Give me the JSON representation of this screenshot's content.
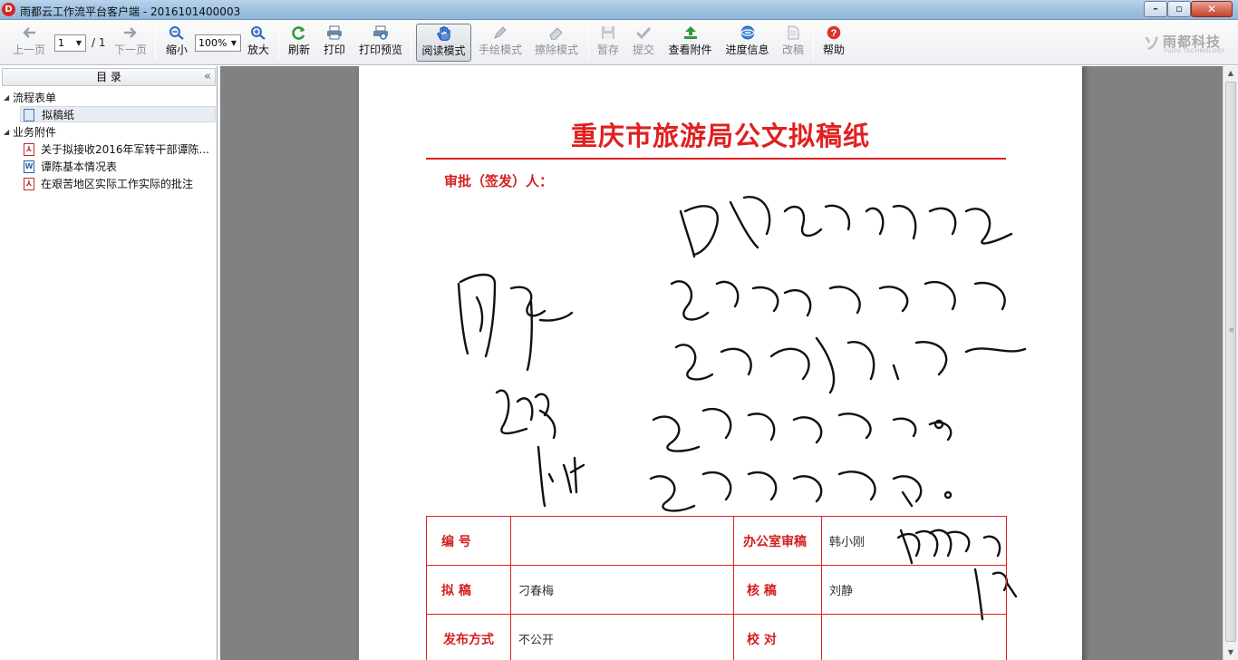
{
  "window": {
    "title": "雨都云工作流平台客户端 - 2016101400003",
    "app_icon": "D",
    "controls": {
      "minimize": "–",
      "maximize": "▫",
      "close": "✕"
    }
  },
  "toolbar": {
    "prev_page": "上一页",
    "page_current": "1",
    "page_total": "/ 1",
    "next_page": "下一页",
    "zoom_out": "缩小",
    "zoom_value": "100%",
    "zoom_in": "放大",
    "refresh": "刷新",
    "print": "打印",
    "print_preview": "打印预览",
    "read_mode": "阅读模式",
    "draw_mode": "手绘模式",
    "erase_mode": "擦除模式",
    "save_draft": "暂存",
    "submit": "提交",
    "view_attachments": "查看附件",
    "progress_info": "进度信息",
    "revise": "改稿",
    "help": "帮助"
  },
  "brand": {
    "mark": "ソ",
    "name_cn": "雨都科技",
    "name_en": "YUDU TECHNOLOGY"
  },
  "sidebar": {
    "title": "目 录",
    "collapse_glyph": "«",
    "groups": [
      {
        "label": "流程表单",
        "items": [
          {
            "label": "拟稿纸",
            "type": "form"
          }
        ]
      },
      {
        "label": "业务附件",
        "items": [
          {
            "label": "关于拟接收2016年军转干部谭陈...",
            "type": "pdf"
          },
          {
            "label": "谭陈基本情况表",
            "type": "word"
          },
          {
            "label": "在艰苦地区实际工作实际的批注",
            "type": "pdf"
          }
        ]
      }
    ]
  },
  "document": {
    "title": "重庆市旅游局公文拟稿纸",
    "approver_label": "审批（签发）人：",
    "table": {
      "number_label": "编  号",
      "number_value": "",
      "office_review_label": "办公室审稿",
      "office_review_value": "韩小刚",
      "drafter_label": "拟  稿",
      "drafter_value": "刁春梅",
      "checker_label": "核  稿",
      "checker_value": "刘静",
      "publish_label": "发布方式",
      "publish_value": "不公开",
      "proofread_label": "校  对",
      "proofread_value": ""
    }
  },
  "icons": {
    "prev": "arrow-left-icon",
    "next": "arrow-right-icon",
    "zoom_out": "zoom-out-icon",
    "zoom_in": "zoom-in-icon",
    "refresh": "refresh-icon",
    "print": "printer-icon",
    "print_preview": "print-preview-icon",
    "read": "hand-icon",
    "draw": "pen-icon",
    "erase": "eraser-icon",
    "save": "floppy-icon",
    "submit": "check-icon",
    "attachment": "upload-arrow-icon",
    "progress": "progress-globe-icon",
    "revise": "document-icon",
    "help": "help-icon"
  },
  "colors": {
    "accent_red": "#e02020",
    "viewer_bg": "#818181"
  }
}
